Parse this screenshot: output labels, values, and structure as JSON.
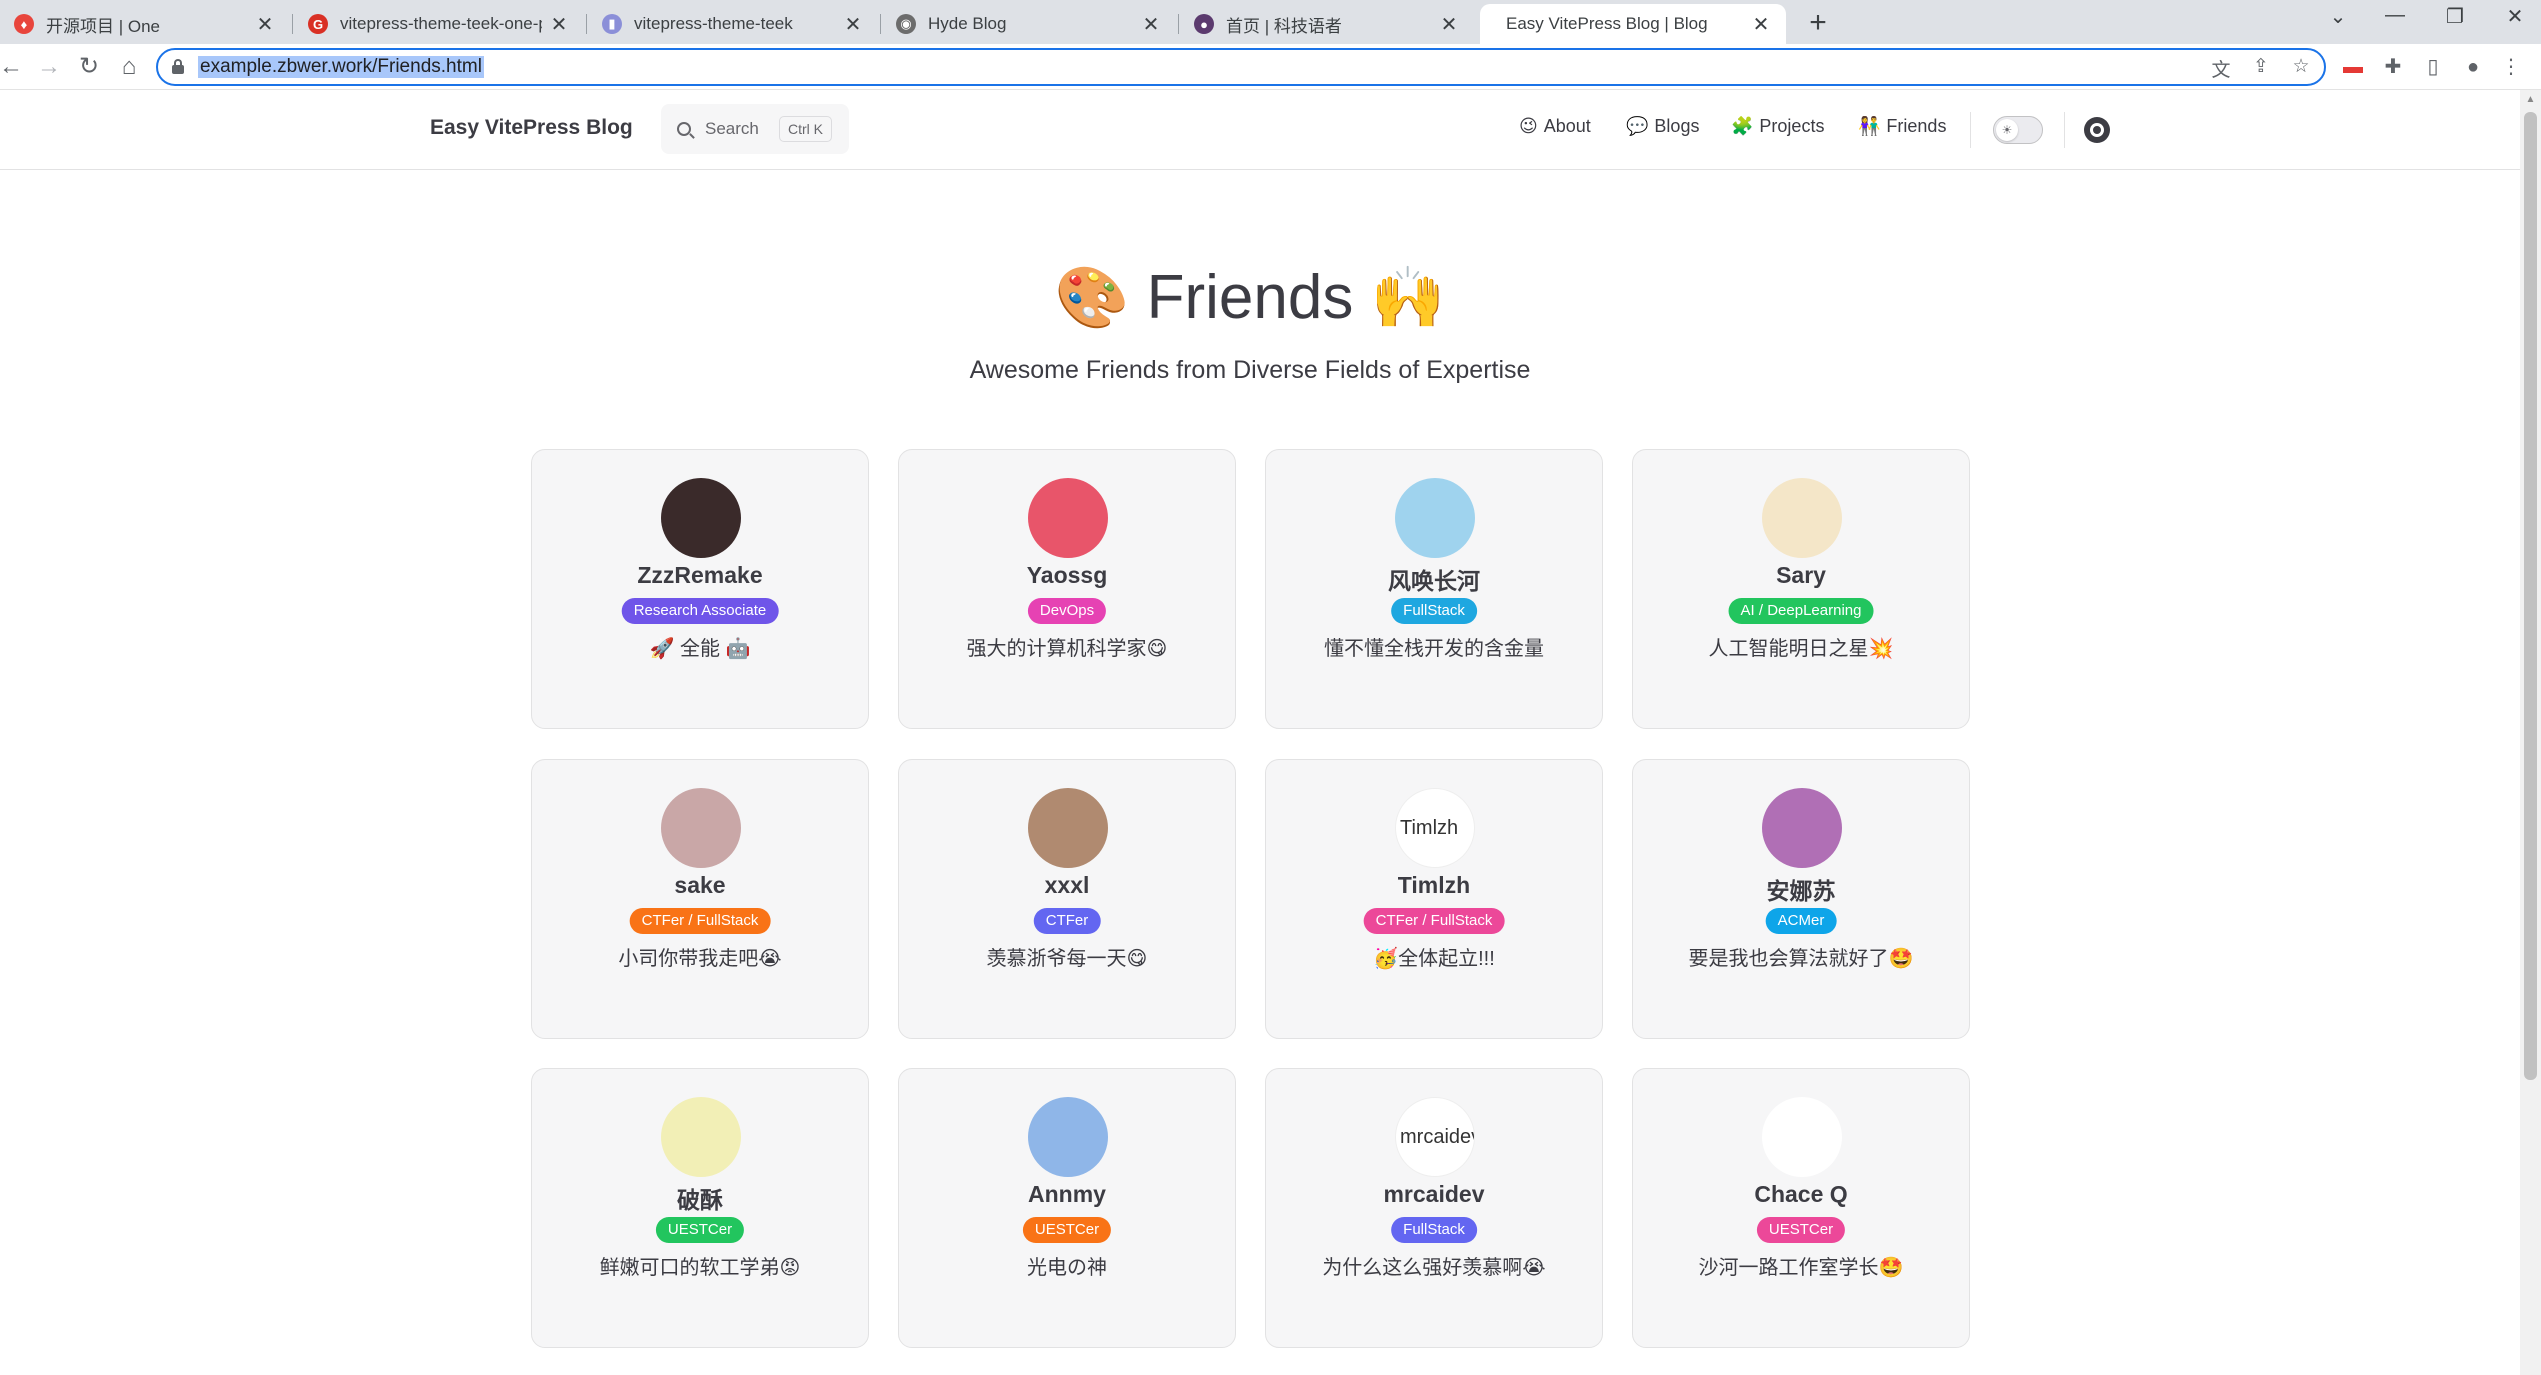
{
  "tabs": [
    {
      "title": "开源项目 | One",
      "color": "#e8453c",
      "glyph": "♦"
    },
    {
      "title": "vitepress-theme-teek-one-pub",
      "color": "#d93025",
      "glyph": "G"
    },
    {
      "title": "vitepress-theme-teek",
      "color": "#8b8fd8",
      "glyph": "▮"
    },
    {
      "title": "Hyde Blog",
      "color": "#6c6c6c",
      "glyph": "◉"
    },
    {
      "title": "首页 | 科技语者",
      "color": "#5b3a6e",
      "glyph": "●"
    },
    {
      "title": "Easy VitePress Blog | Blog",
      "color": "#ffffff",
      "glyph": ""
    }
  ],
  "browser": {
    "url": "example.zbwer.work/Friends.html",
    "new_tab": "+",
    "close": "✕"
  },
  "site": {
    "brand": "Easy VitePress Blog",
    "search_label": "Search",
    "search_kbd": "Ctrl K",
    "nav": [
      {
        "icon": "😉",
        "label": "About"
      },
      {
        "icon": "💬",
        "label": "Blogs"
      },
      {
        "icon": "🧩",
        "label": "Projects"
      },
      {
        "icon": "👫",
        "label": "Friends"
      }
    ]
  },
  "page": {
    "title_emoji_left": "🎨",
    "title": "Friends",
    "title_emoji_right": "🙌",
    "subtitle": "Awesome Friends from Diverse Fields of Expertise"
  },
  "friends": [
    {
      "name": "ZzzRemake",
      "tag": "Research Associate",
      "tag_color": "#6f55e9",
      "desc": "🚀 全能 🤖",
      "avatar_bg": "#3a2a2a",
      "avatar_text": ""
    },
    {
      "name": "Yaossg",
      "tag": "DevOps",
      "tag_color": "#e642b3",
      "desc": "强大的计算机科学家😋",
      "avatar_bg": "#e8556a",
      "avatar_text": ""
    },
    {
      "name": "风唤长河",
      "tag": "FullStack",
      "tag_color": "#1ea7e0",
      "desc": "懂不懂全栈开发的含金量",
      "avatar_bg": "#9fd3ee",
      "avatar_text": ""
    },
    {
      "name": "Sary",
      "tag": "AI / DeepLearning",
      "tag_color": "#22c55e",
      "desc": "人工智能明日之星💥",
      "avatar_bg": "#f4e6c8",
      "avatar_text": ""
    },
    {
      "name": "sake",
      "tag": "CTFer / FullStack",
      "tag_color": "#f97316",
      "desc": "小司你带我走吧😭",
      "avatar_bg": "#c9a7a7",
      "avatar_text": ""
    },
    {
      "name": "xxxl",
      "tag": "CTFer",
      "tag_color": "#6366f1",
      "desc": "羡慕浙爷每一天😋",
      "avatar_bg": "#b08a70",
      "avatar_text": ""
    },
    {
      "name": "Timlzh",
      "tag": "CTFer / FullStack",
      "tag_color": "#ec4899",
      "desc": "🥳全体起立!!!",
      "avatar_bg": "#ffffff",
      "avatar_text": "Timlzh"
    },
    {
      "name": "安娜苏",
      "tag": "ACMer",
      "tag_color": "#0ea5e9",
      "desc": "要是我也会算法就好了🤩",
      "avatar_bg": "#b06fb5",
      "avatar_text": ""
    },
    {
      "name": "破酥",
      "tag": "UESTCer",
      "tag_color": "#22c55e",
      "desc": "鲜嫩可口的软工学弟😡",
      "avatar_bg": "#f2efb6",
      "avatar_text": ""
    },
    {
      "name": "Annmy",
      "tag": "UESTCer",
      "tag_color": "#f97316",
      "desc": "光电の神",
      "avatar_bg": "#8fb6e8",
      "avatar_text": ""
    },
    {
      "name": "mrcaidev",
      "tag": "FullStack",
      "tag_color": "#6366f1",
      "desc": "为什么这么强好羡慕啊😭",
      "avatar_bg": "#ffffff",
      "avatar_text": "mrcaidev"
    },
    {
      "name": "Chace Q",
      "tag": "UESTCer",
      "tag_color": "#ec4899",
      "desc": "沙河一路工作室学长🤩",
      "avatar_bg": "#ffffff",
      "avatar_text": ""
    }
  ]
}
